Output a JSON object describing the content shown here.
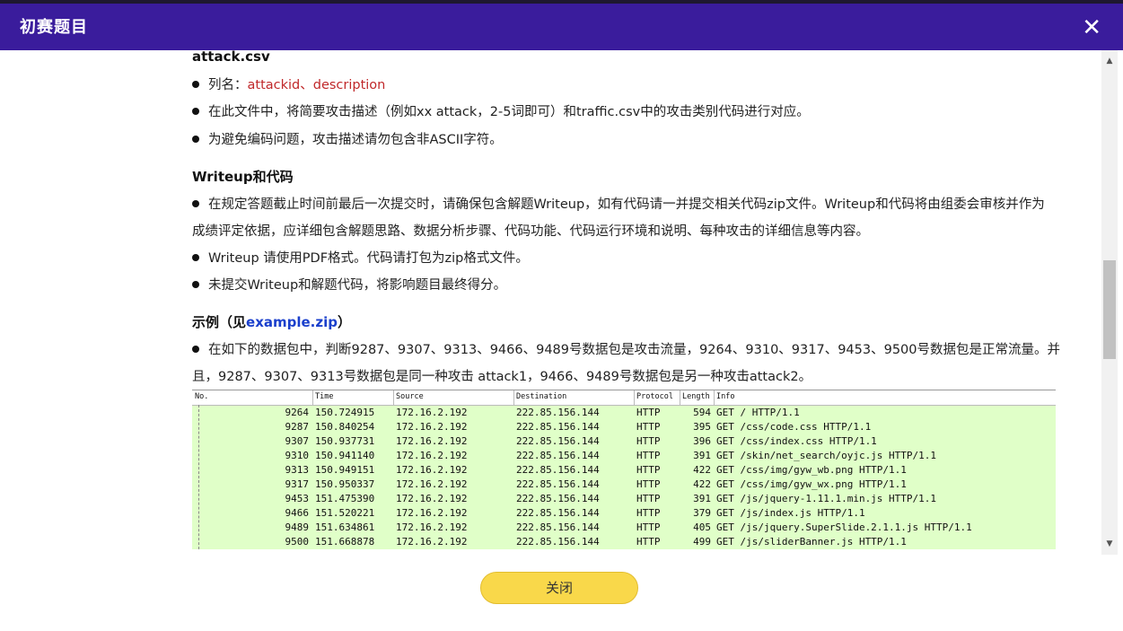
{
  "header": {
    "title": "初赛题目",
    "close_icon": "✕"
  },
  "content": {
    "attack_heading": "attack.csv",
    "attack_items": {
      "columns_label": "列名：",
      "col1": "attackid",
      "col_sep": "、",
      "col2": "description",
      "item2": "在此文件中，将简要攻击描述（例如xx attack，2-5词即可）和traffic.csv中的攻击类别代码进行对应。",
      "item3": "为避免编码问题，攻击描述请勿包含非ASCII字符。"
    },
    "writeup_heading": "Writeup和代码",
    "writeup_items": {
      "item1_line1": "在规定答题截止时间前最后一次提交时，请确保包含解题Writeup，如有代码请一并提交相关代码zip文件。Writeup和代码将由组委会审核并作为",
      "item1_line2": "成绩评定依据，应详细包含解题思路、数据分析步骤、代码功能、代码运行环境和说明、每种攻击的详细信息等内容。",
      "item2": "Writeup 请使用PDF格式。代码请打包为zip格式文件。",
      "item3": "未提交Writeup和解题代码，将影响题目最终得分。"
    },
    "example_heading_prefix": "示例（见",
    "example_link": "example.zip",
    "example_heading_suffix": "）",
    "example_line1": "在如下的数据包中，判断9287、9307、9313、9466、9489号数据包是攻击流量，9264、9310、9317、9453、9500号数据包是正常流量。并",
    "example_line2": "且，9287、9307、9313号数据包是同一种攻击 attack1，9466、9489号数据包是另一种攻击attack2。"
  },
  "packet_table": {
    "headers": [
      "No.",
      "Time",
      "Source",
      "Destination",
      "Protocol",
      "Length",
      "Info"
    ],
    "rows": [
      [
        "9264",
        "150.724915",
        "172.16.2.192",
        "222.85.156.144",
        "HTTP",
        "594",
        "GET / HTTP/1.1"
      ],
      [
        "9287",
        "150.840254",
        "172.16.2.192",
        "222.85.156.144",
        "HTTP",
        "395",
        "GET /css/code.css HTTP/1.1"
      ],
      [
        "9307",
        "150.937731",
        "172.16.2.192",
        "222.85.156.144",
        "HTTP",
        "396",
        "GET /css/index.css HTTP/1.1"
      ],
      [
        "9310",
        "150.941140",
        "172.16.2.192",
        "222.85.156.144",
        "HTTP",
        "391",
        "GET /skin/net_search/oyjc.js HTTP/1.1"
      ],
      [
        "9313",
        "150.949151",
        "172.16.2.192",
        "222.85.156.144",
        "HTTP",
        "422",
        "GET /css/img/gyw_wb.png HTTP/1.1"
      ],
      [
        "9317",
        "150.950337",
        "172.16.2.192",
        "222.85.156.144",
        "HTTP",
        "422",
        "GET /css/img/gyw_wx.png HTTP/1.1"
      ],
      [
        "9453",
        "151.475390",
        "172.16.2.192",
        "222.85.156.144",
        "HTTP",
        "391",
        "GET /js/jquery-1.11.1.min.js HTTP/1.1"
      ],
      [
        "9466",
        "151.520221",
        "172.16.2.192",
        "222.85.156.144",
        "HTTP",
        "379",
        "GET /js/index.js HTTP/1.1"
      ],
      [
        "9489",
        "151.634861",
        "172.16.2.192",
        "222.85.156.144",
        "HTTP",
        "405",
        "GET /js/jquery.SuperSlide.2.1.1.js HTTP/1.1"
      ],
      [
        "9500",
        "151.668878",
        "172.16.2.192",
        "222.85.156.144",
        "HTTP",
        "499",
        "GET /js/sliderBanner.js HTTP/1.1"
      ]
    ]
  },
  "footer": {
    "close_button": "关闭"
  },
  "scrollbar": {
    "up_icon": "▲",
    "down_icon": "▼"
  }
}
